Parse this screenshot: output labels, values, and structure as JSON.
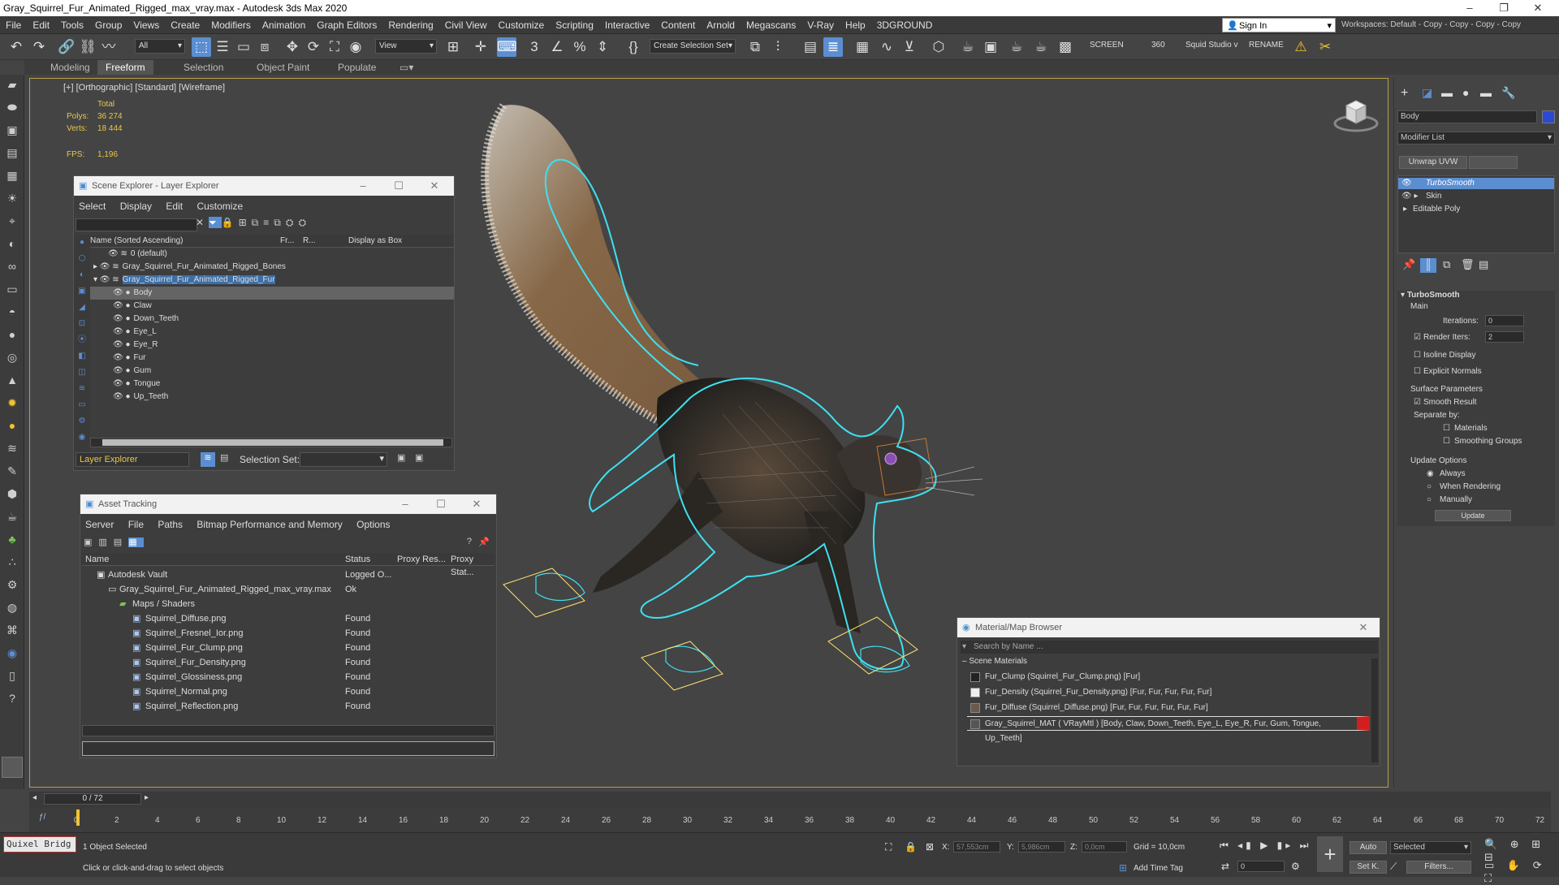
{
  "window": {
    "title": "Gray_Squirrel_Fur_Animated_Rigged_max_vray.max - Autodesk 3ds Max 2020"
  },
  "menu": [
    "File",
    "Edit",
    "Tools",
    "Group",
    "Views",
    "Create",
    "Modifiers",
    "Animation",
    "Graph Editors",
    "Rendering",
    "Civil View",
    "Customize",
    "Scripting",
    "Interactive",
    "Content",
    "Arnold",
    "Megascans",
    "V-Ray",
    "Help",
    "3DGROUND"
  ],
  "signin": "Sign In",
  "workspace": "Workspaces:  Default - Copy - Copy - Copy - Copy",
  "toolbar": {
    "filter": "All",
    "refcoord": "View",
    "selection_set": "Create Selection Set",
    "screen": "SCREEN",
    "num360": "360",
    "squid": "Squid Studio v",
    "rename": "RENAME"
  },
  "ribbon": {
    "tabs": [
      "Modeling",
      "Freeform",
      "Selection",
      "Object Paint",
      "Populate"
    ]
  },
  "viewport": {
    "label": "[+] [Orthographic] [Standard] [Wireframe]",
    "stats": {
      "total": "Total",
      "polys_label": "Polys:",
      "polys": "36 274",
      "verts_label": "Verts:",
      "verts": "18 444",
      "fps_label": "FPS:",
      "fps": "1,196"
    }
  },
  "scene_explorer": {
    "title": "Scene Explorer - Layer Explorer",
    "menu": [
      "Select",
      "Display",
      "Edit",
      "Customize"
    ],
    "columns": [
      "Name (Sorted Ascending)",
      "Fr...",
      "R...",
      "Display as Box"
    ],
    "rows": [
      {
        "name": "0 (default)"
      },
      {
        "name": "Gray_Squirrel_Fur_Animated_Rigged_Bones"
      },
      {
        "name": "Gray_Squirrel_Fur_Animated_Rigged_Fur"
      },
      {
        "name": "Body"
      },
      {
        "name": "Claw"
      },
      {
        "name": "Down_Teeth"
      },
      {
        "name": "Eye_L"
      },
      {
        "name": "Eye_R"
      },
      {
        "name": "Fur"
      },
      {
        "name": "Gum"
      },
      {
        "name": "Tongue"
      },
      {
        "name": "Up_Teeth"
      }
    ],
    "footer_mode": "Layer Explorer",
    "selection_set_label": "Selection Set:"
  },
  "asset_tracking": {
    "title": "Asset Tracking",
    "menu": [
      "Server",
      "File",
      "Paths",
      "Bitmap Performance and Memory",
      "Options"
    ],
    "columns": [
      "Name",
      "Status",
      "Proxy Res...",
      "Proxy Stat..."
    ],
    "rows": [
      {
        "name": "Autodesk Vault",
        "status": "Logged O..."
      },
      {
        "name": "Gray_Squirrel_Fur_Animated_Rigged_max_vray.max",
        "status": "Ok"
      },
      {
        "name": "Maps / Shaders",
        "status": ""
      },
      {
        "name": "Squirrel_Diffuse.png",
        "status": "Found"
      },
      {
        "name": "Squirrel_Fresnel_Ior.png",
        "status": "Found"
      },
      {
        "name": "Squirrel_Fur_Clump.png",
        "status": "Found"
      },
      {
        "name": "Squirrel_Fur_Density.png",
        "status": "Found"
      },
      {
        "name": "Squirrel_Glossiness.png",
        "status": "Found"
      },
      {
        "name": "Squirrel_Normal.png",
        "status": "Found"
      },
      {
        "name": "Squirrel_Reflection.png",
        "status": "Found"
      }
    ]
  },
  "material_browser": {
    "title": "Material/Map Browser",
    "search_placeholder": "Search by Name ...",
    "section": "Scene Materials",
    "rows": [
      "Fur_Clump (Squirrel_Fur_Clump.png)  [Fur]",
      "Fur_Density (Squirrel_Fur_Density.png)  [Fur, Fur, Fur, Fur, Fur]",
      "Fur_Diffuse (Squirrel_Diffuse.png)  [Fur, Fur, Fur, Fur, Fur, Fur]",
      "Gray_Squirrel_MAT  ( VRayMtl )  [Body, Claw, Down_Teeth, Eye_L, Eye_R, Fur, Gum, Tongue, Up_Teeth]"
    ]
  },
  "command_panel": {
    "object_name": "Body",
    "modifier_list": "Modifier List",
    "unwrap": "Unwrap UVW",
    "stack": [
      "TurboSmooth",
      "Skin",
      "Editable Poly"
    ],
    "rollout": "TurboSmooth",
    "main": "Main",
    "iterations_label": "Iterations:",
    "iterations": "0",
    "render_iters_label": "Render Iters:",
    "render_iters": "2",
    "isoline": "Isoline Display",
    "explicit_normals": "Explicit Normals",
    "surface_params": "Surface Parameters",
    "smooth_result": "Smooth Result",
    "separate_by": "Separate by:",
    "materials": "Materials",
    "smoothing_groups": "Smoothing Groups",
    "update_options": "Update Options",
    "always": "Always",
    "when_rendering": "When Rendering",
    "manually": "Manually",
    "update_btn": "Update"
  },
  "timeline": {
    "frame": "0 / 72",
    "ticks": [
      "0",
      "2",
      "4",
      "6",
      "8",
      "10",
      "12",
      "14",
      "16",
      "18",
      "20",
      "22",
      "24",
      "26",
      "28",
      "30",
      "32",
      "34",
      "36",
      "38",
      "40",
      "42",
      "44",
      "46",
      "48",
      "50",
      "52",
      "54",
      "56",
      "58",
      "60",
      "62",
      "64",
      "66",
      "68",
      "70",
      "72"
    ]
  },
  "status": {
    "quixel": "Quixel Bridg",
    "selected": "1 Object Selected",
    "hint": "Click or click-and-drag to select objects",
    "x_label": "X:",
    "x": "57,553cm",
    "y_label": "Y:",
    "y": "5,986cm",
    "z_label": "Z:",
    "z": "0,0cm",
    "grid": "Grid = 10,0cm",
    "add_time_tag": "Add Time Tag",
    "auto": "Auto",
    "selected_dd": "Selected",
    "setk": "Set K.",
    "filters": "Filters...",
    "frame_field": "0"
  },
  "colors": {
    "accent": "#5b8ed1",
    "selection_cyan": "#3ee0f0",
    "viewport_border": "#b8a04a",
    "stat_yellow": "#e6c84a",
    "highlight_red": "#d11f1f"
  }
}
